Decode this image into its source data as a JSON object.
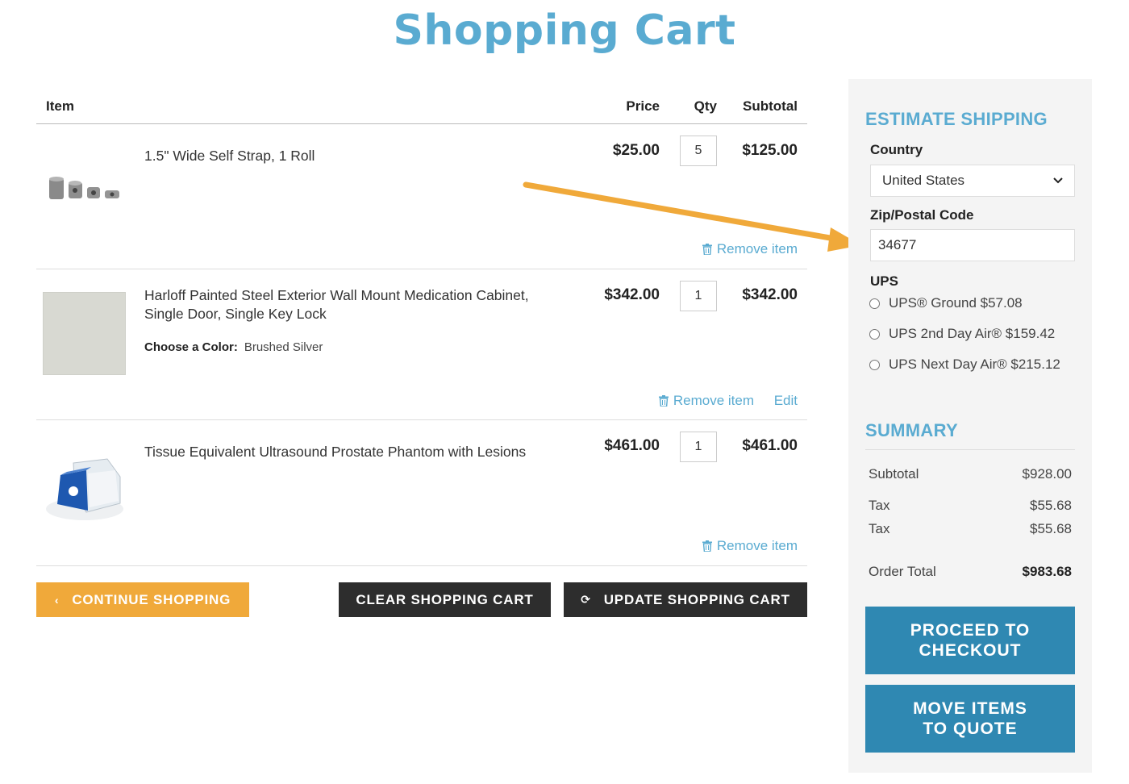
{
  "page": {
    "title": "Shopping Cart"
  },
  "cart": {
    "headers": {
      "item": "Item",
      "price": "Price",
      "qty": "Qty",
      "subtotal": "Subtotal"
    },
    "items": [
      {
        "name": "1.5\" Wide Self Strap, 1 Roll",
        "price": "$25.00",
        "qty": "5",
        "subtotal": "$125.00",
        "remove": "Remove item"
      },
      {
        "name_line1": "Harloff Painted Steel Exterior Wall Mount Medication Cabinet,",
        "name_line2": "Single Door, Single Key Lock",
        "option_label": "Choose a Color:",
        "option_value": "Brushed Silver",
        "price": "$342.00",
        "qty": "1",
        "subtotal": "$342.00",
        "remove": "Remove item",
        "edit": "Edit"
      },
      {
        "name": "Tissue Equivalent Ultrasound Prostate Phantom with Lesions",
        "price": "$461.00",
        "qty": "1",
        "subtotal": "$461.00",
        "remove": "Remove item"
      }
    ],
    "buttons": {
      "continue": "CONTINUE SHOPPING",
      "clear": "CLEAR SHOPPING CART",
      "update": "UPDATE SHOPPING CART"
    }
  },
  "shipping": {
    "title": "ESTIMATE SHIPPING",
    "country_label": "Country",
    "country_value": "United States",
    "zip_label": "Zip/Postal Code",
    "zip_value": "34677",
    "carrier": "UPS",
    "options": [
      {
        "label": "UPS® Ground $57.08"
      },
      {
        "label": "UPS 2nd Day Air® $159.42"
      },
      {
        "label": "UPS Next Day Air® $215.12"
      }
    ]
  },
  "summary": {
    "title": "SUMMARY",
    "subtotal_label": "Subtotal",
    "subtotal_value": "$928.00",
    "tax1_label": "Tax",
    "tax1_value": "$55.68",
    "tax2_label": "Tax",
    "tax2_value": "$55.68",
    "total_label": "Order Total",
    "total_value": "$983.68",
    "checkout_line1": "PROCEED TO",
    "checkout_line2": "CHECKOUT",
    "quote_line1": "MOVE ITEMS",
    "quote_line2": "TO QUOTE"
  },
  "colors": {
    "accent": "#5aabd1",
    "orange": "#f0a93a",
    "dark": "#2d2d2d",
    "button_blue": "#2f88b2",
    "arrow": "#f0a93a"
  },
  "icons": [
    "trash-icon",
    "chevron-left-icon",
    "refresh-icon",
    "chevron-down-icon",
    "arrow-annotation"
  ]
}
